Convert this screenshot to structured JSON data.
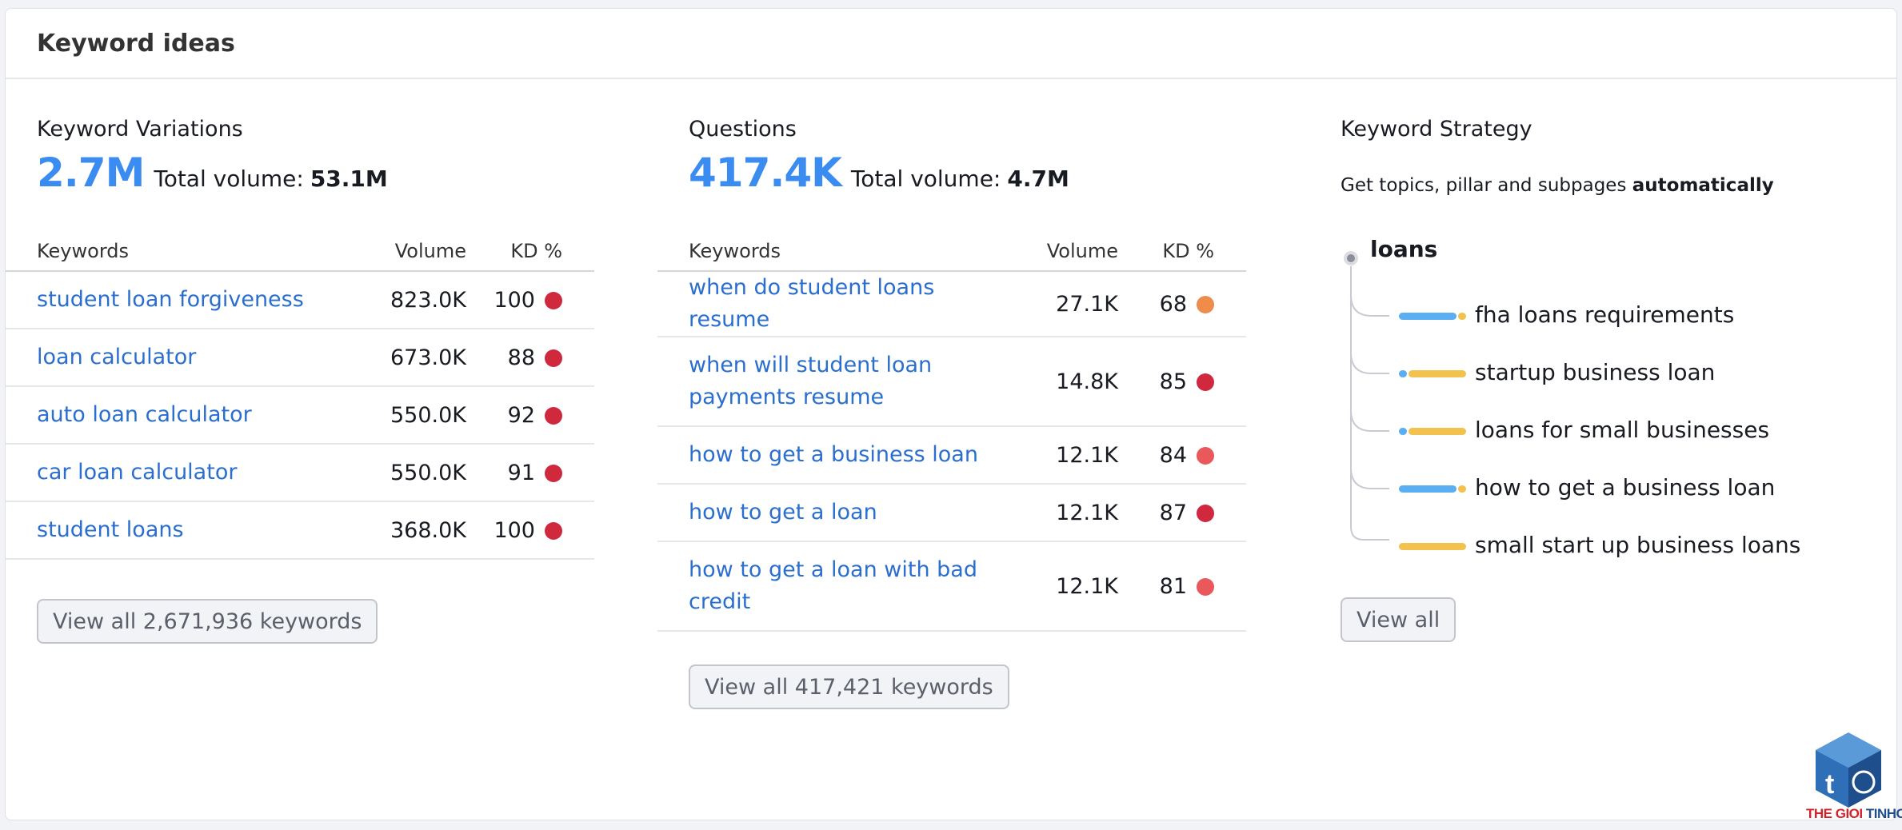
{
  "card": {
    "title": "Keyword ideas"
  },
  "variations": {
    "heading": "Keyword Variations",
    "count": "2.7M",
    "total_label": "Total volume:",
    "total_value": "53.1M",
    "columns": {
      "keywords": "Keywords",
      "volume": "Volume",
      "kd": "KD %"
    },
    "rows": [
      {
        "keyword": "student loan forgiveness",
        "volume": "823.0K",
        "kd": "100",
        "kd_color": "#d0283d"
      },
      {
        "keyword": "loan calculator",
        "volume": "673.0K",
        "kd": "88",
        "kd_color": "#d0283d"
      },
      {
        "keyword": "auto loan calculator",
        "volume": "550.0K",
        "kd": "92",
        "kd_color": "#d0283d"
      },
      {
        "keyword": "car loan calculator",
        "volume": "550.0K",
        "kd": "91",
        "kd_color": "#d0283d"
      },
      {
        "keyword": "student loans",
        "volume": "368.0K",
        "kd": "100",
        "kd_color": "#d0283d"
      }
    ],
    "button": "View all 2,671,936 keywords"
  },
  "questions": {
    "heading": "Questions",
    "count": "417.4K",
    "total_label": "Total volume:",
    "total_value": "4.7M",
    "columns": {
      "keywords": "Keywords",
      "volume": "Volume",
      "kd": "KD %"
    },
    "rows": [
      {
        "keyword": "when do student loans resume",
        "volume": "27.1K",
        "kd": "68",
        "kd_color": "#ee8c4b"
      },
      {
        "keyword": "when will student loan payments resume",
        "volume": "14.8K",
        "kd": "85",
        "kd_color": "#d0283d"
      },
      {
        "keyword": "how to get a business loan",
        "volume": "12.1K",
        "kd": "84",
        "kd_color": "#e9585a"
      },
      {
        "keyword": "how to get a loan",
        "volume": "12.1K",
        "kd": "87",
        "kd_color": "#d0283d"
      },
      {
        "keyword": "how to get a loan with bad credit",
        "volume": "12.1K",
        "kd": "81",
        "kd_color": "#e9585a"
      }
    ],
    "button": "View all 417,421 keywords"
  },
  "strategy": {
    "heading": "Keyword Strategy",
    "desc_prefix": "Get topics, pillar and subpages ",
    "desc_bold": "automatically",
    "root": "loans",
    "items": [
      "fha loans requirements",
      "startup business loan",
      "loans for small businesses",
      "how to get a business loan",
      "small start up business loans"
    ],
    "button": "View all"
  },
  "colors": {
    "accent": "#3b8cf0",
    "link": "#2a6fcf",
    "bar_blue": "#5aaef2",
    "bar_yellow": "#f2c14e"
  },
  "watermark": {
    "part1": "THE GIOI ",
    "part2": "TINHOC"
  }
}
